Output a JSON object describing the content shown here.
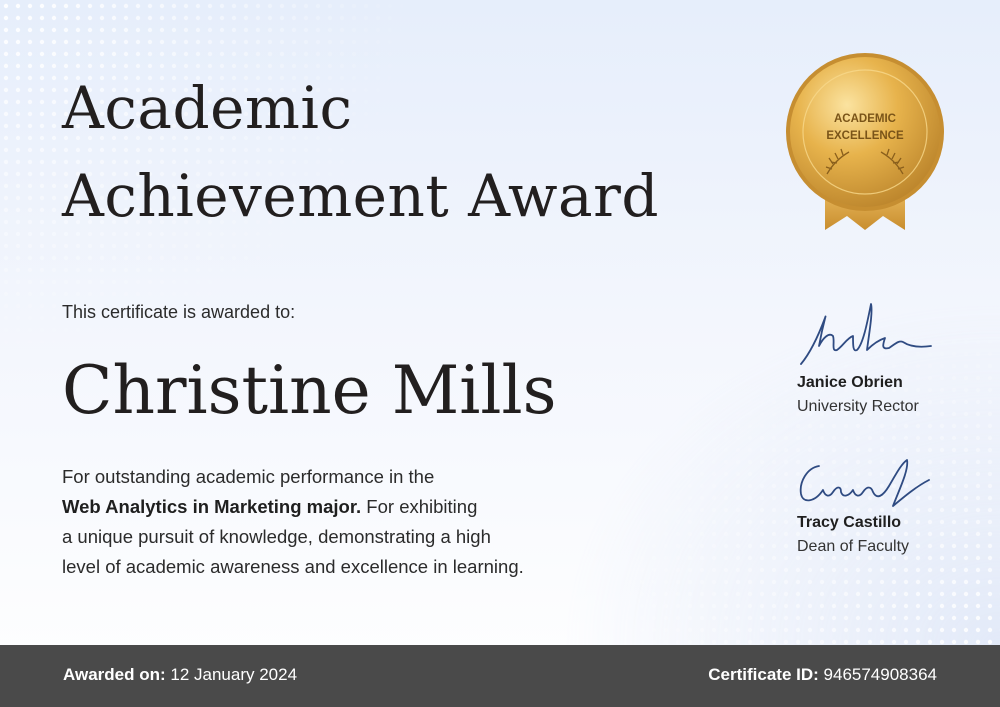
{
  "certificate": {
    "title_line1": "Academic",
    "title_line2": "Achievement Award",
    "awarded_to_label": "This certificate is awarded to:",
    "recipient_name": "Christine Mills",
    "description": {
      "line1": "For outstanding academic performance in the",
      "major": "Web Analytics in Marketing major.",
      "line2_rest": " For exhibiting",
      "line3": "a unique pursuit of knowledge, demonstrating a high",
      "line4": "level of academic awareness and excellence in learning."
    }
  },
  "medal": {
    "line1": "ACADEMIC",
    "line2": "EXCELLENCE",
    "icon": "laurel-icon",
    "color": "#e0a93a"
  },
  "signatories": [
    {
      "name": "Janice Obrien",
      "role": "University Rector"
    },
    {
      "name": "Tracy Castillo",
      "role": "Dean of Faculty"
    }
  ],
  "footer": {
    "awarded_label": "Awarded on:",
    "awarded_date": " 12 January 2024",
    "id_label": "Certificate ID:",
    "id_value": " 946574908364"
  },
  "colors": {
    "footer_bg": "#4a4a4a",
    "signature_ink": "#2f4b82",
    "text": "#221f1f"
  }
}
